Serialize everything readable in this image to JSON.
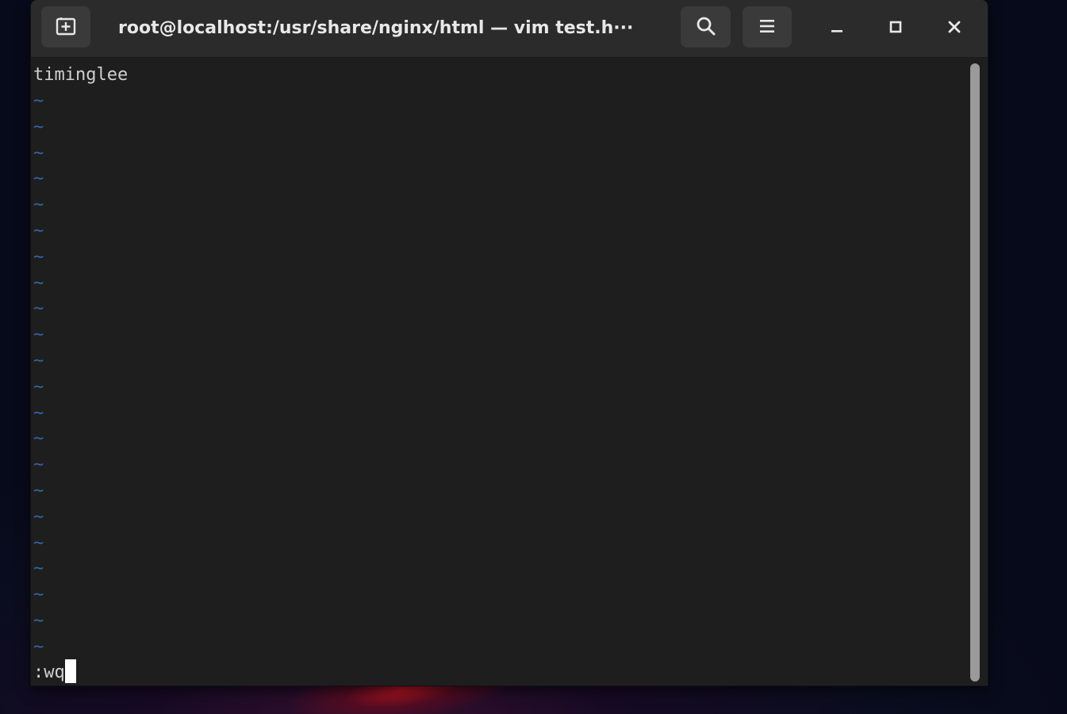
{
  "window": {
    "title": "root@localhost:/usr/share/nginx/html — vim test.h···"
  },
  "header": {
    "new_tab_icon": "new-tab-icon",
    "search_icon": "search-icon",
    "menu_icon": "hamburger-menu-icon",
    "minimize_icon": "minimize-icon",
    "maximize_icon": "maximize-icon",
    "close_icon": "close-icon"
  },
  "editor": {
    "content_line": "timinglee",
    "empty_marker": "~",
    "empty_line_count": 22,
    "command_line": ":wq"
  },
  "colors": {
    "terminal_bg": "#1e1e1e",
    "text": "#d0d0d0",
    "tilde": "#3465a4",
    "headerbar": "#2b2b2b"
  }
}
